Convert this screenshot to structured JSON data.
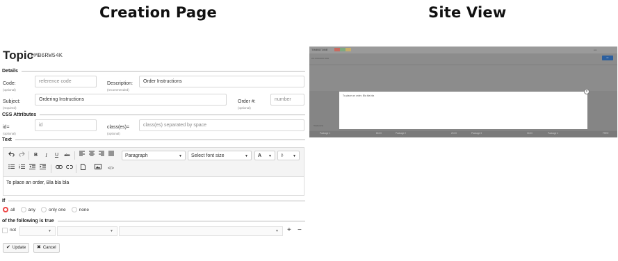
{
  "headings": {
    "left": "Creation Page",
    "right": "Site View"
  },
  "topic": {
    "title": "Topic",
    "id": "#MB6RW54K"
  },
  "sections": {
    "details": "Details",
    "css": "CSS Attributes",
    "text": "Text",
    "if": "If",
    "following": "of the following is true"
  },
  "fields": {
    "code": {
      "label": "Code:",
      "hint": "(optional)",
      "placeholder": "reference code"
    },
    "description": {
      "label": "Description:",
      "hint": "(recommended)",
      "value": "Order Instructions"
    },
    "subject": {
      "label": "Subject:",
      "hint": "(required)",
      "value": "Ordering Instructions"
    },
    "order": {
      "label": "Order #:",
      "hint": "(optional)",
      "placeholder": "number"
    },
    "css_id": {
      "label": "id=",
      "hint": "(optional)",
      "placeholder": "id"
    },
    "css_class": {
      "label": "class(es)=",
      "hint": "(optional)",
      "placeholder": "class(es) separated by space"
    }
  },
  "toolbar": {
    "bold": "B",
    "italic": "I",
    "underline": "U",
    "strike": "abc",
    "paragraph": "Paragraph",
    "font_size": "Select font size",
    "text_color": "A",
    "source": "</>"
  },
  "editor": {
    "content": "To place an order, Bla bla bla"
  },
  "if_options": [
    {
      "label": "all",
      "selected": true
    },
    {
      "label": "any",
      "selected": false
    },
    {
      "label": "only one",
      "selected": false
    },
    {
      "label": "none",
      "selected": false
    }
  ],
  "condition": {
    "not_label": "not",
    "add": "+",
    "remove": "−"
  },
  "actions": {
    "update": "Update",
    "cancel": "Cancel"
  },
  "site": {
    "logo": "TIMBSTONE",
    "modal_text": "To place an order, Bla bla bla",
    "total_label": "Total (incl)",
    "packages": [
      {
        "name": "Package 1",
        "price": "80.00"
      },
      {
        "name": "Package 2",
        "price": "20.00"
      },
      {
        "name": "Package 3",
        "price": "30.00"
      },
      {
        "name": "Package 4",
        "price": "FREE"
      }
    ],
    "colors": {
      "overlay": "#8c8c8c",
      "button": "#2c5f9e",
      "flag": [
        "#d43a2f",
        "#3a9a3f",
        "#e2b52b"
      ]
    }
  },
  "colors": {
    "radio_selected": "#e44444",
    "rule": "#b8b8b8"
  }
}
